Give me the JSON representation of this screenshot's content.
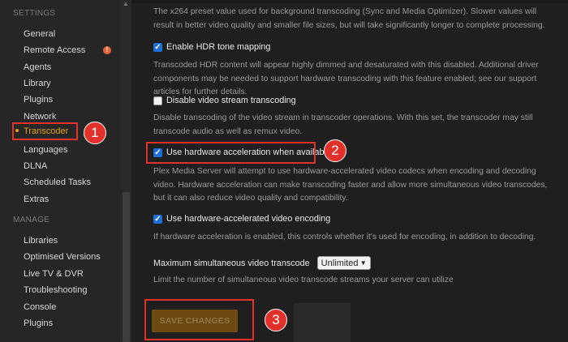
{
  "sidebar": {
    "settings_title": "SETTINGS",
    "manage_title": "MANAGE",
    "settings_items": [
      "General",
      "Remote Access",
      "Agents",
      "Library",
      "Plugins",
      "Network",
      "Transcoder",
      "Languages",
      "DLNA",
      "Scheduled Tasks",
      "Extras"
    ],
    "manage_items": [
      "Libraries",
      "Optimised Versions",
      "Live TV & DVR",
      "Troubleshooting",
      "Console",
      "Plugins"
    ],
    "active_item": "Transcoder",
    "alert_icon": "!"
  },
  "main": {
    "x264_desc": "The x264 preset value used for background transcoding (Sync and Media Optimizer). Slower values will result in better video quality and smaller file sizes, but will take significantly longer to complete processing.",
    "hdr": {
      "label": "Enable HDR tone mapping",
      "checked": true,
      "desc": "Transcoded HDR content will appear highly dimmed and desaturated with this disabled. Additional driver components may be needed to support hardware transcoding with this feature enabled; see our support articles for further details."
    },
    "disable_video": {
      "label": "Disable video stream transcoding",
      "checked": false,
      "desc": "Disable transcoding of the video stream in transcoder operations. With this set, the transcoder may still transcode audio as well as remux video."
    },
    "hw_accel": {
      "label": "Use hardware acceleration when available",
      "checked": true,
      "desc": "Plex Media Server will attempt to use hardware-accelerated video codecs when encoding and decoding video. Hardware acceleration can make transcoding faster and allow more simultaneous video transcodes, but it can also reduce video quality and compatibility."
    },
    "hw_encoding": {
      "label": "Use hardware-accelerated video encoding",
      "checked": true,
      "desc": "If hardware acceleration is enabled, this controls whether it's used for encoding, in addition to decoding."
    },
    "max_transcode": {
      "label": "Maximum simultaneous video transcode",
      "value": "Unlimited",
      "desc": "Limit the number of simultaneous video transcode streams your server can utilize"
    },
    "save_label": "SAVE CHANGES"
  },
  "annotations": [
    "1",
    "2",
    "3"
  ],
  "colors": {
    "accent": "#e5a00d",
    "highlight": "#e2312a",
    "checkbox": "#1e6fd6"
  }
}
